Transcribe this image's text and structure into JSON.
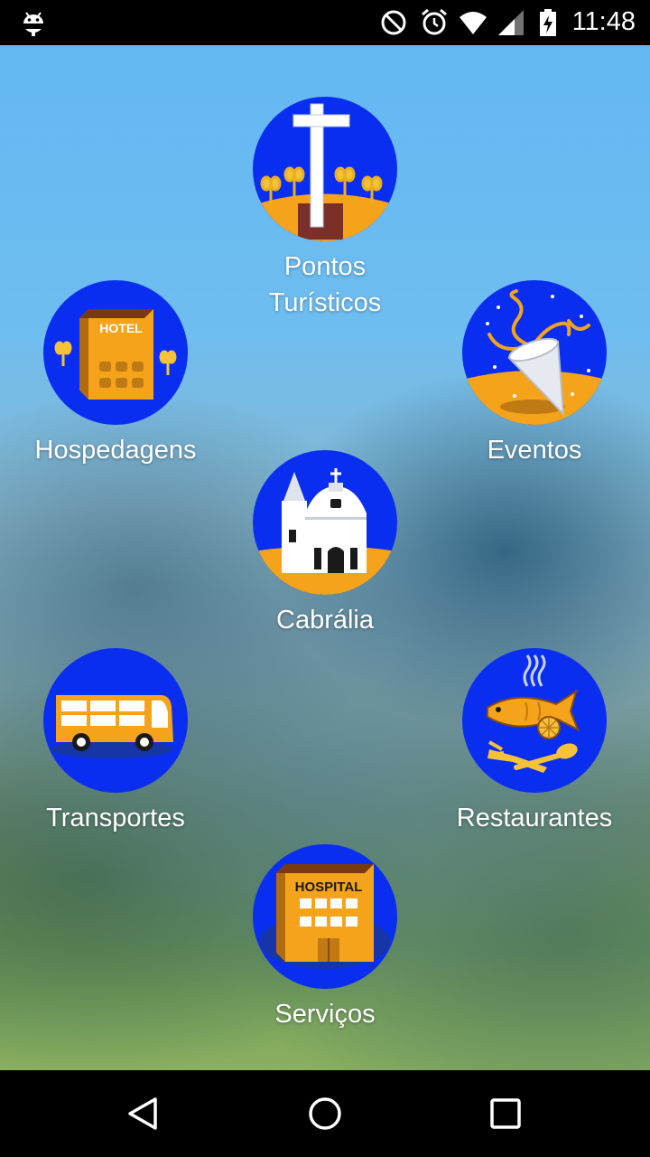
{
  "status_bar": {
    "time": "11:48",
    "icons": [
      "android-debug-icon",
      "do-not-disturb-icon",
      "alarm-icon",
      "wifi-icon",
      "signal-icon",
      "battery-charging-icon"
    ]
  },
  "menu": {
    "pontos": {
      "label_line1": "Pontos",
      "label_line2": "Turísticos",
      "icon": "cross-icon"
    },
    "hospedagens": {
      "label": "Hospedagens",
      "icon": "hotel-icon",
      "sign": "HOTEL"
    },
    "eventos": {
      "label": "Eventos",
      "icon": "party-horn-icon"
    },
    "cabralia": {
      "label": "Cabrália",
      "icon": "church-icon"
    },
    "transportes": {
      "label": "Transportes",
      "icon": "bus-icon"
    },
    "restaurantes": {
      "label": "Restaurantes",
      "icon": "fish-dish-icon"
    },
    "servicos": {
      "label": "Serviços",
      "icon": "hospital-icon",
      "sign": "HOSPITAL"
    }
  },
  "nav_bar": {
    "buttons": [
      "back-icon",
      "home-icon",
      "recents-icon"
    ]
  },
  "colors": {
    "circle_blue": "#0a2ef0",
    "accent_orange": "#f5a31a",
    "label_white": "#ffffff"
  }
}
